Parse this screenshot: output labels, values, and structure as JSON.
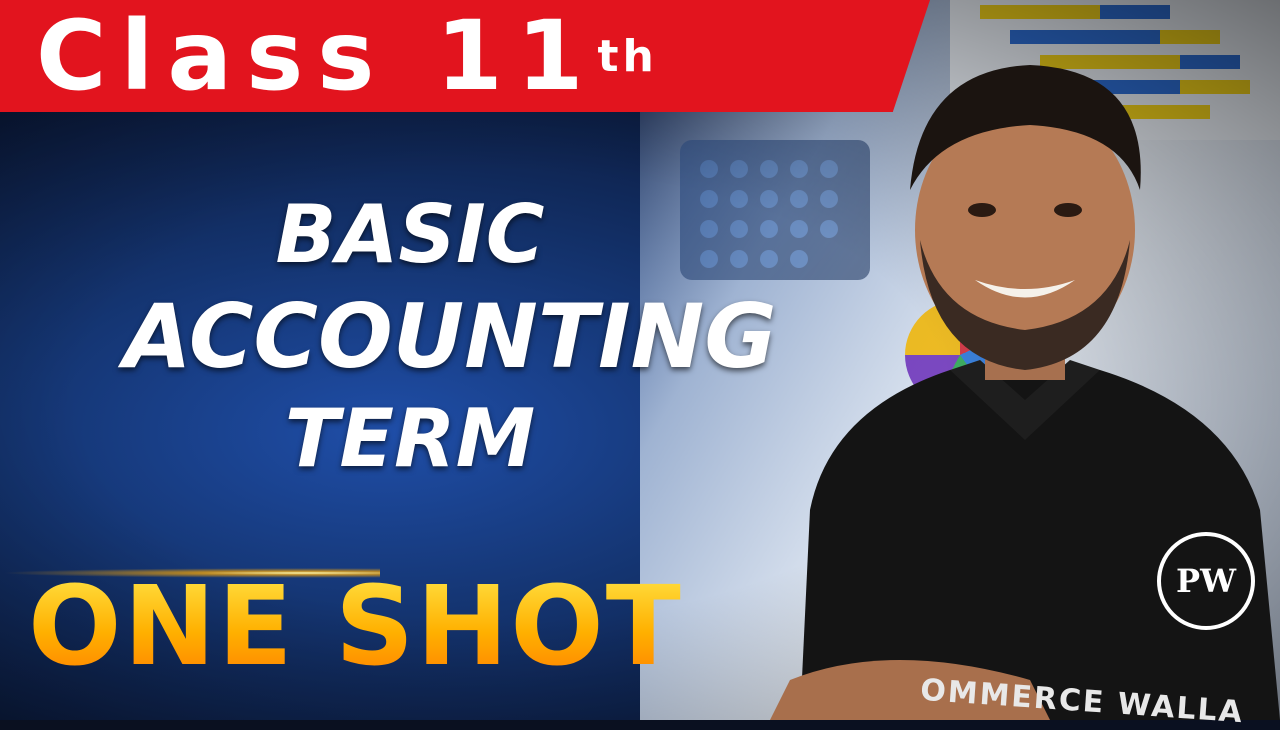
{
  "banner": {
    "title": "Class 11",
    "superscript": "th"
  },
  "topic": {
    "line1": "BASIC",
    "line2": "ACCOUNTING",
    "line3": "TERM"
  },
  "tagline": "ONE SHOT",
  "logo": {
    "text": "PW"
  },
  "shirt": {
    "text": "OMMERCE WALLA"
  },
  "colors": {
    "banner": "#e2141e",
    "tagline_top": "#ffe94d",
    "tagline_bottom": "#ff7a00",
    "background": "#143470"
  }
}
